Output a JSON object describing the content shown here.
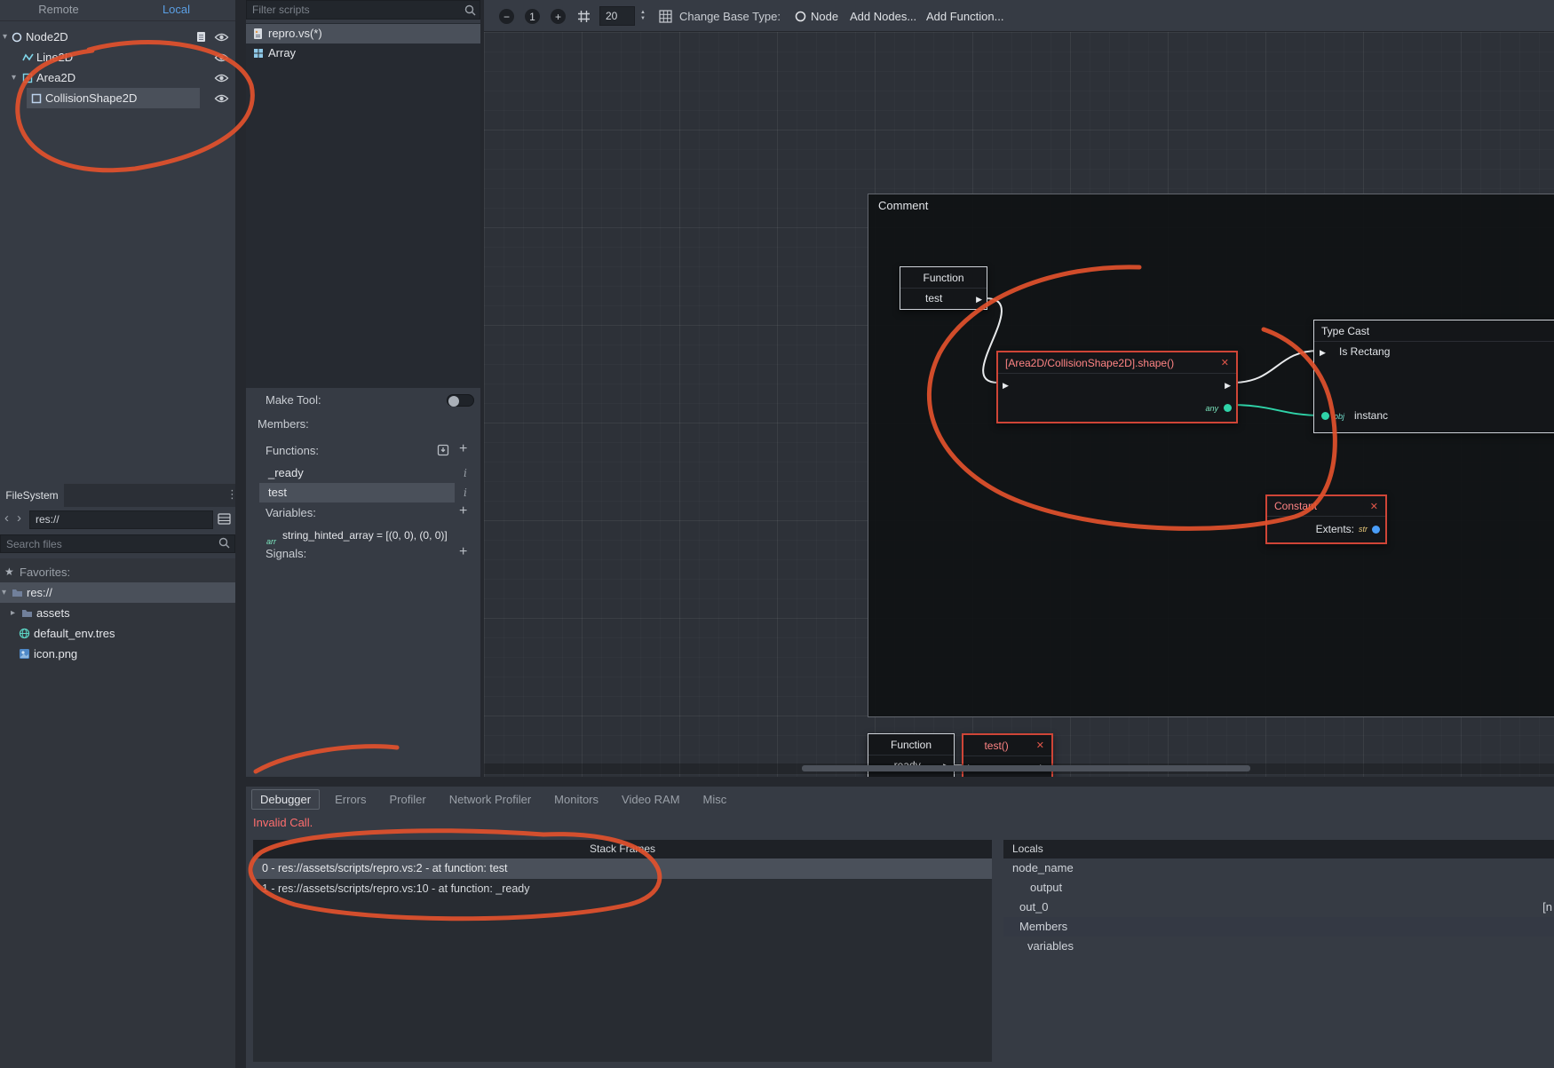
{
  "colors": {
    "accent": "#5b9fe4",
    "error": "#ff6e6e",
    "annotation": "#e2512c",
    "node-red": "#cf4537",
    "node-red-text": "#ff8484",
    "teal": "#2fd3a8",
    "blue-port": "#4a9df8",
    "selection": "#4a505a"
  },
  "icons": {
    "zoom_out": "−",
    "zoom_reset": "1",
    "zoom_in": "+",
    "caret_down": "▾",
    "caret_right": "▸",
    "star": "★",
    "dots": "⋮",
    "nav_back": "‹",
    "nav_fwd": "›",
    "close": "✕",
    "play": "▶",
    "plus": "+",
    "info": "i",
    "spin_up": "▲",
    "spin_down": "▼"
  },
  "scene": {
    "tab_remote": "Remote",
    "tab_local": "Local",
    "nodes": [
      {
        "label": "Node2D"
      },
      {
        "label": "Line2D"
      },
      {
        "label": "Area2D"
      },
      {
        "label": "CollisionShape2D"
      }
    ]
  },
  "scripts": {
    "filter_placeholder": "Filter scripts",
    "items": [
      {
        "label": "repro.vs(*)"
      },
      {
        "label": "Array"
      }
    ],
    "make_tool": "Make Tool:",
    "members": "Members:",
    "functions_label": "Functions:",
    "functions": [
      {
        "label": "_ready"
      },
      {
        "label": "test"
      }
    ],
    "variables_label": "Variables:",
    "variable_type": "arr",
    "variable_text": "string_hinted_array = [(0, 0), (0, 0)]",
    "signals_label": "Signals:"
  },
  "filesystem": {
    "title": "FileSystem",
    "path": "res://",
    "search_placeholder": "Search files",
    "favorites": "Favorites:",
    "items": [
      {
        "label": "res://"
      },
      {
        "label": "assets"
      },
      {
        "label": "default_env.tres"
      },
      {
        "label": "icon.png"
      }
    ]
  },
  "toolbar": {
    "snap_value": "20",
    "base_type_label": "Change Base Type:",
    "base_type": "Node",
    "add_nodes": "Add Nodes...",
    "add_function": "Add Function..."
  },
  "graph": {
    "comment_title": "Comment",
    "function_node": {
      "title": "Function",
      "name": "test"
    },
    "call_node": {
      "title": "[Area2D/CollisionShape2D].shape()",
      "out_type": "any"
    },
    "cast_node": {
      "title": "Type Cast",
      "row1": "Is Rectang",
      "in_type": "obj",
      "row2": "instanc"
    },
    "constant_node": {
      "title": "Constant",
      "field": "Extents:",
      "type": "str"
    },
    "ready_node": {
      "title": "Function",
      "name": "_ready"
    },
    "test_node": {
      "title": "test()"
    }
  },
  "debugger": {
    "tabs": [
      {
        "label": "Debugger"
      },
      {
        "label": "Errors"
      },
      {
        "label": "Profiler"
      },
      {
        "label": "Network Profiler"
      },
      {
        "label": "Monitors"
      },
      {
        "label": "Video RAM"
      },
      {
        "label": "Misc"
      }
    ],
    "error": "Invalid Call.",
    "stack_title": "Stack Frames",
    "frames": [
      {
        "text": "0 - res://assets/scripts/repro.vs:2 - at function: test"
      },
      {
        "text": "1 - res://assets/scripts/repro.vs:10 - at function: _ready"
      }
    ],
    "locals": {
      "title": "Locals",
      "row1": "node_name",
      "row2": "output",
      "row3": "out_0",
      "row3_value": "[n",
      "row4": "Members",
      "row5": "variables"
    }
  }
}
